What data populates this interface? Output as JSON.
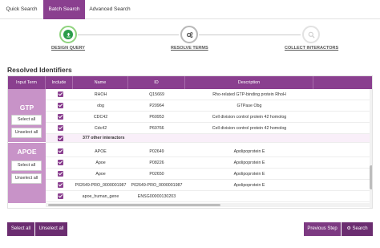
{
  "tabs": [
    {
      "label": "Quick Search"
    },
    {
      "label": "Batch Search"
    },
    {
      "label": "Advanced Search"
    }
  ],
  "steps": [
    {
      "label": "DESIGN QUERY",
      "icon": "upload-icon"
    },
    {
      "label": "RESOLVE TERMS",
      "icon": "gears-icon"
    },
    {
      "label": "COLLECT INTERACTORS",
      "icon": "search-icon"
    }
  ],
  "section_title": "Resolved Identifiers",
  "table": {
    "headers": [
      "Input Term",
      "Include",
      "Name",
      "ID",
      "Description"
    ],
    "groups": [
      {
        "term": "GTP",
        "select_all": "Select all",
        "unselect_all": "Unselect all",
        "rows": [
          {
            "name": "RHOH",
            "id": "Q15669",
            "desc": "Rho-related GTP-binding protein RhoH"
          },
          {
            "name": "obg",
            "id": "P20964",
            "desc": "GTPase Obg"
          },
          {
            "name": "CDC42",
            "id": "P60953",
            "desc": "Cell division control protein 42 homolog"
          },
          {
            "name": "Cdc42",
            "id": "P60766",
            "desc": "Cell division control protein 42 homolog"
          }
        ],
        "other_label": "377 other interactors"
      },
      {
        "term": "APOE",
        "select_all": "Select all",
        "unselect_all": "Unselect all",
        "rows": [
          {
            "name": "APOE",
            "id": "P02649",
            "desc": "Apolipoprotein E"
          },
          {
            "name": "Apoe",
            "id": "P08226",
            "desc": "Apolipoprotein E"
          },
          {
            "name": "Apoe",
            "id": "P02650",
            "desc": "Apolipoprotein E"
          },
          {
            "name": "P02649-PRO_0000001987",
            "id": "P02649-PRO_0000001987",
            "desc": "Apolipoprotein E"
          },
          {
            "name": "apoe_human_gene",
            "id": "ENSG00000130203",
            "desc": ""
          }
        ]
      }
    ]
  },
  "footer": {
    "select_all": "Select all",
    "unselect_all": "Unselect all",
    "previous_step": "Previous Step",
    "search": "Search"
  },
  "colors": {
    "primary": "#8a3f8f",
    "group_bg": "#c893c8",
    "success": "#2b9c4a"
  }
}
